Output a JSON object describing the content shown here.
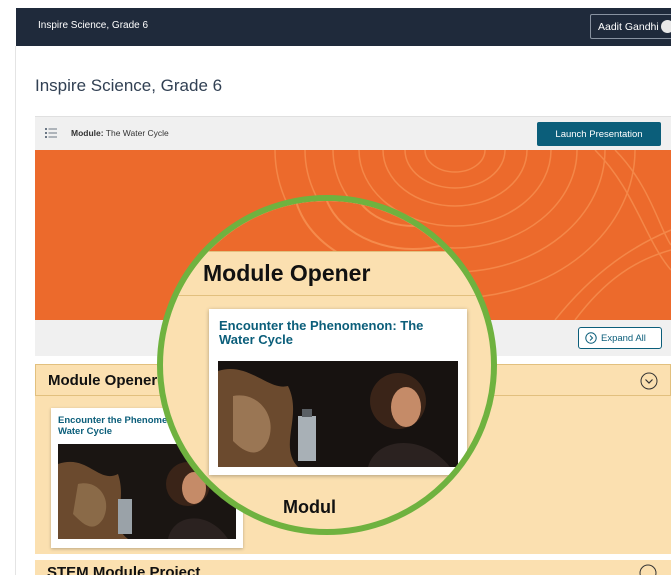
{
  "topbar": {
    "app_title": "Inspire Science, Grade 6",
    "user_name": "Aadit Gandhi"
  },
  "page": {
    "title": "Inspire Science, Grade 6"
  },
  "module_bar": {
    "prefix": "Module:",
    "name": "The Water Cycle",
    "launch_label": "Launch Presentation"
  },
  "toolbar": {
    "expand_all_label": "Expand All"
  },
  "sections": [
    {
      "title": "Module Opener",
      "cards": [
        {
          "title": "Encounter the Phenomenon: The Water Cycle"
        }
      ]
    },
    {
      "title": "STEM Module Project"
    }
  ],
  "magnifier": {
    "header_title": "Module Opener",
    "card_title": "Encounter the Phenomenon: The Water Cycle",
    "next_text": "Modul"
  },
  "colors": {
    "topbar": "#1f2a3b",
    "accent": "#0b5e7a",
    "banner": "#ec6a2c",
    "section_bg": "#fbe0b0",
    "magnifier_ring": "#6fb23f"
  },
  "icons": [
    "list-icon",
    "expand-icon",
    "chevron-down-icon",
    "avatar"
  ]
}
